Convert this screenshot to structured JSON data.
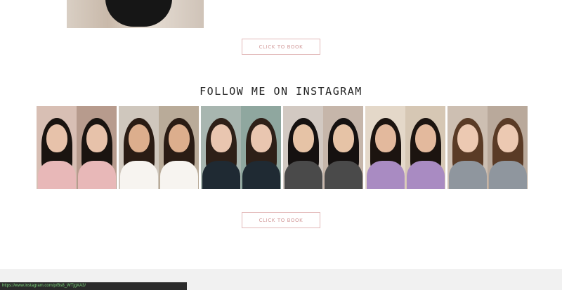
{
  "section": {
    "title": "FOLLOW ME ON INSTAGRAM"
  },
  "buttons": {
    "book_top": "CLICK TO BOOK",
    "book_bottom": "CLICK TO BOOK"
  },
  "status_bar": {
    "url": "https://www.instagram.com/p/Bs8_WTjgXA3/"
  },
  "instagram_posts": [
    {
      "name": "post-1",
      "bg": [
        "#d8bfb4",
        "#b79b8d"
      ],
      "hair": "#1a1410",
      "skin": "#e7c2aa",
      "top": "#e8b8b8"
    },
    {
      "name": "post-2",
      "bg": [
        "#cfc7bd",
        "#b9ab99"
      ],
      "hair": "#2a1c14",
      "skin": "#dcae8d",
      "top": "#f7f4f0"
    },
    {
      "name": "post-3",
      "bg": [
        "#a8b6b0",
        "#8fa79f"
      ],
      "hair": "#2e2018",
      "skin": "#e9c6b0",
      "top": "#1f2a33"
    },
    {
      "name": "post-4",
      "bg": [
        "#d2c9c2",
        "#c6b6aa"
      ],
      "hair": "#151110",
      "skin": "#e6c3a6",
      "top": "#4a4a4a"
    },
    {
      "name": "post-5",
      "bg": [
        "#e4d8c9",
        "#d6c7b4"
      ],
      "hair": "#1c1410",
      "skin": "#e3b99d",
      "top": "#a98bc2"
    },
    {
      "name": "post-6",
      "bg": [
        "#cdbfb2",
        "#b9a99b"
      ],
      "hair": "#5a3b26",
      "skin": "#ecc9b2",
      "top": "#8f969e"
    }
  ]
}
